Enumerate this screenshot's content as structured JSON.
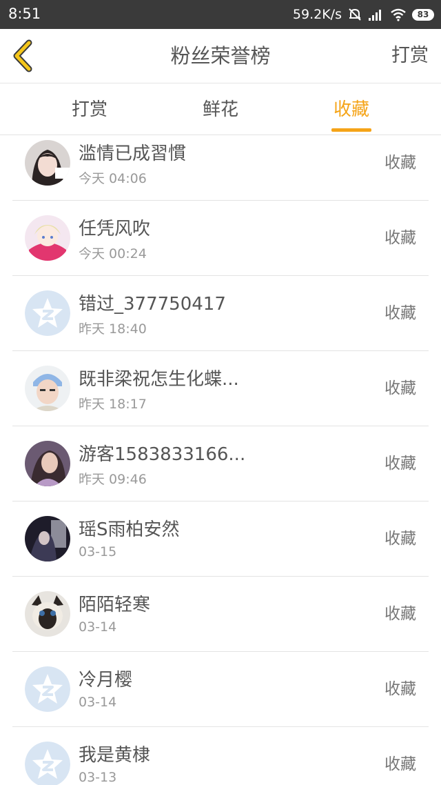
{
  "status_bar": {
    "time": "8:51",
    "net_speed": "59.2K/s",
    "battery": "83"
  },
  "header": {
    "title": "粉丝荣誉榜",
    "action_label": "打赏",
    "back_icon": "chevron-left-icon",
    "accent": "#f5a418"
  },
  "tabs": [
    {
      "label": "打赏",
      "active": false
    },
    {
      "label": "鲜花",
      "active": false
    },
    {
      "label": "收藏",
      "active": true
    }
  ],
  "list": [
    {
      "name": "滥情已成習慣",
      "time": "今天 04:06",
      "action": "收藏",
      "avatar": "photo-girl"
    },
    {
      "name": "任凭风吹",
      "time": "今天 00:24",
      "action": "收藏",
      "avatar": "anime-girl"
    },
    {
      "name": "错过_377750417",
      "time": "昨天 18:40",
      "action": "收藏",
      "avatar": "default-star"
    },
    {
      "name": "既非梁祝怎生化蝶...",
      "time": "昨天 18:17",
      "action": "收藏",
      "avatar": "photo-child"
    },
    {
      "name": "游客1583833166...",
      "time": "昨天 09:46",
      "action": "收藏",
      "avatar": "photo-purple"
    },
    {
      "name": "瑶S雨柏安然",
      "time": "03-15",
      "action": "收藏",
      "avatar": "photo-dark"
    },
    {
      "name": "陌陌轻寒",
      "time": "03-14",
      "action": "收藏",
      "avatar": "photo-cat"
    },
    {
      "name": "冷月樱",
      "time": "03-14",
      "action": "收藏",
      "avatar": "default-star"
    },
    {
      "name": "我是黄棣",
      "time": "03-13",
      "action": "收藏",
      "avatar": "default-star"
    }
  ]
}
